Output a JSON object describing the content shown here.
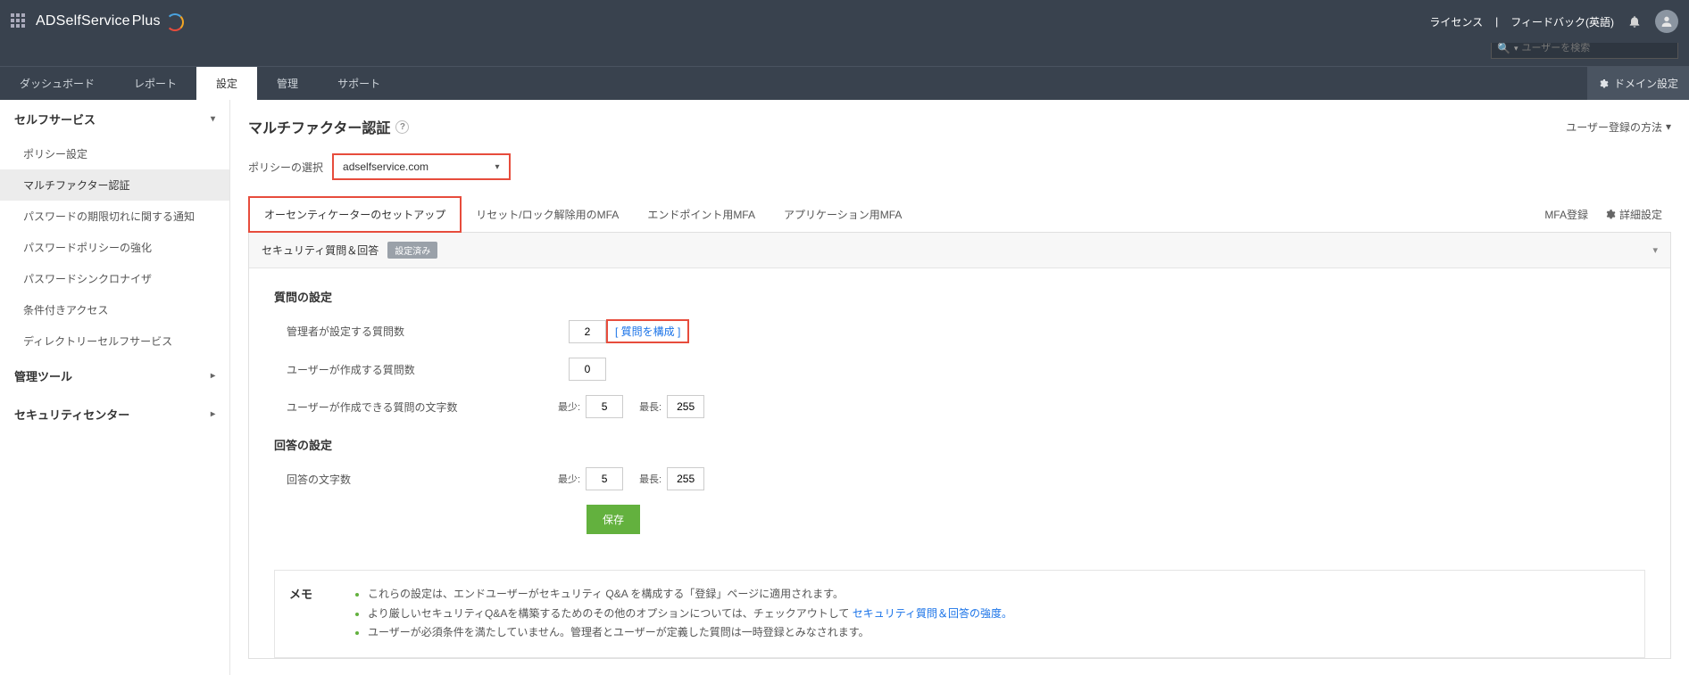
{
  "brand": {
    "name": "ADSelfService",
    "suffix": "Plus"
  },
  "top_links": {
    "license": "ライセンス",
    "feedback": "フィードバック(英語)"
  },
  "search": {
    "placeholder": "ユーザーを検索"
  },
  "nav": {
    "tabs": [
      "ダッシュボード",
      "レポート",
      "設定",
      "管理",
      "サポート"
    ],
    "active": 2,
    "domain_settings": "ドメイン設定"
  },
  "sidebar": {
    "sections": [
      {
        "title": "セルフサービス",
        "expanded": true,
        "items": [
          "ポリシー設定",
          "マルチファクター認証",
          "パスワードの期限切れに関する通知",
          "パスワードポリシーの強化",
          "パスワードシンクロナイザ",
          "条件付きアクセス",
          "ディレクトリーセルフサービス"
        ],
        "active_index": 1
      },
      {
        "title": "管理ツール",
        "expanded": false
      },
      {
        "title": "セキュリティセンター",
        "expanded": false
      }
    ]
  },
  "page": {
    "title": "マルチファクター認証",
    "reg_method": "ユーザー登録の方法"
  },
  "policy": {
    "label": "ポリシーの選択",
    "value": "adselfservice.com"
  },
  "subtabs": {
    "items": [
      "オーセンティケーターのセットアップ",
      "リセット/ロック解除用のMFA",
      "エンドポイント用MFA",
      "アプリケーション用MFA"
    ],
    "active": 0,
    "mfa_reg": "MFA登録",
    "adv": "詳細設定"
  },
  "panel": {
    "head": "セキュリティ質問＆回答",
    "badge": "設定済み"
  },
  "q_section": {
    "title": "質問の設定",
    "admin_q_label": "管理者が設定する質問数",
    "admin_q_val": "2",
    "configure_link": "[ 質問を構成 ]",
    "user_q_label": "ユーザーが作成する質問数",
    "user_q_val": "0",
    "char_label": "ユーザーが作成できる質問の文字数",
    "min_label": "最少:",
    "min_val": "5",
    "max_label": "最長:",
    "max_val": "255"
  },
  "a_section": {
    "title": "回答の設定",
    "char_label": "回答の文字数",
    "min_val": "5",
    "max_val": "255"
  },
  "save": "保存",
  "note": {
    "label": "メモ",
    "items": [
      "これらの設定は、エンドユーザーがセキュリティ Q&A を構成する「登録」ページに適用されます。",
      "より厳しいセキュリティQ&Aを構築するためのその他のオプションについては、チェックアウトして ",
      "ユーザーが必須条件を満たしていません。管理者とユーザーが定義した質問は一時登録とみなされます。"
    ],
    "link": "セキュリティ質問＆回答の強度。"
  }
}
